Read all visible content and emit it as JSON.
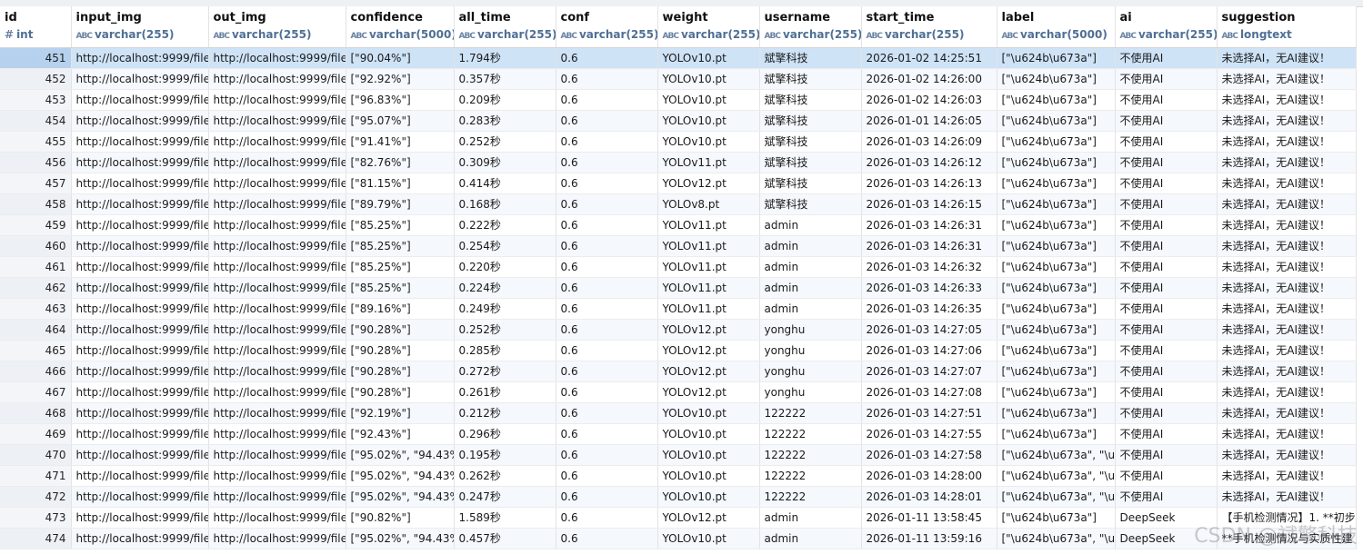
{
  "columns": [
    {
      "name": "id",
      "type": "int",
      "glyph": "#"
    },
    {
      "name": "input_img",
      "type": "varchar(255)",
      "glyph": "ABC"
    },
    {
      "name": "out_img",
      "type": "varchar(255)",
      "glyph": "ABC"
    },
    {
      "name": "confidence",
      "type": "varchar(5000)",
      "glyph": "ABC"
    },
    {
      "name": "all_time",
      "type": "varchar(255)",
      "glyph": "ABC"
    },
    {
      "name": "conf",
      "type": "varchar(255)",
      "glyph": "ABC"
    },
    {
      "name": "weight",
      "type": "varchar(255)",
      "glyph": "ABC"
    },
    {
      "name": "username",
      "type": "varchar(255)",
      "glyph": "ABC"
    },
    {
      "name": "start_time",
      "type": "varchar(255)",
      "glyph": "ABC"
    },
    {
      "name": "label",
      "type": "varchar(5000)",
      "glyph": "ABC"
    },
    {
      "name": "ai",
      "type": "varchar(255)",
      "glyph": "ABC"
    },
    {
      "name": "suggestion",
      "type": "longtext",
      "glyph": "ABC"
    }
  ],
  "rows": [
    [
      "451",
      "http://localhost:9999/file",
      "http://localhost:9999/file",
      "[\"90.04%\"]",
      "1.794秒",
      "0.6",
      "YOLOv10.pt",
      "斌擎科技",
      "2026-01-02 14:25:51",
      "[\"\\u624b\\u673a\"]",
      "不使用AI",
      "未选择AI，无AI建议！"
    ],
    [
      "452",
      "http://localhost:9999/file",
      "http://localhost:9999/file",
      "[\"92.92%\"]",
      "0.357秒",
      "0.6",
      "YOLOv10.pt",
      "斌擎科技",
      "2026-01-02 14:26:00",
      "[\"\\u624b\\u673a\"]",
      "不使用AI",
      "未选择AI，无AI建议！"
    ],
    [
      "453",
      "http://localhost:9999/file",
      "http://localhost:9999/file",
      "[\"96.83%\"]",
      "0.209秒",
      "0.6",
      "YOLOv10.pt",
      "斌擎科技",
      "2026-01-02 14:26:03",
      "[\"\\u624b\\u673a\"]",
      "不使用AI",
      "未选择AI，无AI建议！"
    ],
    [
      "454",
      "http://localhost:9999/file",
      "http://localhost:9999/file",
      "[\"95.07%\"]",
      "0.283秒",
      "0.6",
      "YOLOv10.pt",
      "斌擎科技",
      "2026-01-01 14:26:05",
      "[\"\\u624b\\u673a\"]",
      "不使用AI",
      "未选择AI，无AI建议！"
    ],
    [
      "455",
      "http://localhost:9999/file",
      "http://localhost:9999/file",
      "[\"91.41%\"]",
      "0.252秒",
      "0.6",
      "YOLOv10.pt",
      "斌擎科技",
      "2026-01-03 14:26:09",
      "[\"\\u624b\\u673a\"]",
      "不使用AI",
      "未选择AI，无AI建议！"
    ],
    [
      "456",
      "http://localhost:9999/file",
      "http://localhost:9999/file",
      "[\"82.76%\"]",
      "0.309秒",
      "0.6",
      "YOLOv11.pt",
      "斌擎科技",
      "2026-01-03 14:26:12",
      "[\"\\u624b\\u673a\"]",
      "不使用AI",
      "未选择AI，无AI建议！"
    ],
    [
      "457",
      "http://localhost:9999/file",
      "http://localhost:9999/file",
      "[\"81.15%\"]",
      "0.414秒",
      "0.6",
      "YOLOv12.pt",
      "斌擎科技",
      "2026-01-03 14:26:13",
      "[\"\\u624b\\u673a\"]",
      "不使用AI",
      "未选择AI，无AI建议！"
    ],
    [
      "458",
      "http://localhost:9999/file",
      "http://localhost:9999/file",
      "[\"89.79%\"]",
      "0.168秒",
      "0.6",
      "YOLOv8.pt",
      "斌擎科技",
      "2026-01-03 14:26:15",
      "[\"\\u624b\\u673a\"]",
      "不使用AI",
      "未选择AI，无AI建议！"
    ],
    [
      "459",
      "http://localhost:9999/file",
      "http://localhost:9999/file",
      "[\"85.25%\"]",
      "0.222秒",
      "0.6",
      "YOLOv11.pt",
      "admin",
      "2026-01-03 14:26:31",
      "[\"\\u624b\\u673a\"]",
      "不使用AI",
      "未选择AI，无AI建议！"
    ],
    [
      "460",
      "http://localhost:9999/file",
      "http://localhost:9999/file",
      "[\"85.25%\"]",
      "0.254秒",
      "0.6",
      "YOLOv11.pt",
      "admin",
      "2026-01-03 14:26:31",
      "[\"\\u624b\\u673a\"]",
      "不使用AI",
      "未选择AI，无AI建议！"
    ],
    [
      "461",
      "http://localhost:9999/file",
      "http://localhost:9999/file",
      "[\"85.25%\"]",
      "0.220秒",
      "0.6",
      "YOLOv11.pt",
      "admin",
      "2026-01-03 14:26:32",
      "[\"\\u624b\\u673a\"]",
      "不使用AI",
      "未选择AI，无AI建议！"
    ],
    [
      "462",
      "http://localhost:9999/file",
      "http://localhost:9999/file",
      "[\"85.25%\"]",
      "0.224秒",
      "0.6",
      "YOLOv11.pt",
      "admin",
      "2026-01-03 14:26:33",
      "[\"\\u624b\\u673a\"]",
      "不使用AI",
      "未选择AI，无AI建议！"
    ],
    [
      "463",
      "http://localhost:9999/file",
      "http://localhost:9999/file",
      "[\"89.16%\"]",
      "0.249秒",
      "0.6",
      "YOLOv11.pt",
      "admin",
      "2026-01-03 14:26:35",
      "[\"\\u624b\\u673a\"]",
      "不使用AI",
      "未选择AI，无AI建议！"
    ],
    [
      "464",
      "http://localhost:9999/file",
      "http://localhost:9999/file",
      "[\"90.28%\"]",
      "0.252秒",
      "0.6",
      "YOLOv12.pt",
      "yonghu",
      "2026-01-03 14:27:05",
      "[\"\\u624b\\u673a\"]",
      "不使用AI",
      "未选择AI，无AI建议！"
    ],
    [
      "465",
      "http://localhost:9999/file",
      "http://localhost:9999/file",
      "[\"90.28%\"]",
      "0.285秒",
      "0.6",
      "YOLOv12.pt",
      "yonghu",
      "2026-01-03 14:27:06",
      "[\"\\u624b\\u673a\"]",
      "不使用AI",
      "未选择AI，无AI建议！"
    ],
    [
      "466",
      "http://localhost:9999/file",
      "http://localhost:9999/file",
      "[\"90.28%\"]",
      "0.272秒",
      "0.6",
      "YOLOv12.pt",
      "yonghu",
      "2026-01-03 14:27:07",
      "[\"\\u624b\\u673a\"]",
      "不使用AI",
      "未选择AI，无AI建议！"
    ],
    [
      "467",
      "http://localhost:9999/file",
      "http://localhost:9999/file",
      "[\"90.28%\"]",
      "0.261秒",
      "0.6",
      "YOLOv12.pt",
      "yonghu",
      "2026-01-03 14:27:08",
      "[\"\\u624b\\u673a\"]",
      "不使用AI",
      "未选择AI，无AI建议！"
    ],
    [
      "468",
      "http://localhost:9999/file",
      "http://localhost:9999/file",
      "[\"92.19%\"]",
      "0.212秒",
      "0.6",
      "YOLOv10.pt",
      "122222",
      "2026-01-03 14:27:51",
      "[\"\\u624b\\u673a\"]",
      "不使用AI",
      "未选择AI，无AI建议！"
    ],
    [
      "469",
      "http://localhost:9999/file",
      "http://localhost:9999/file",
      "[\"92.43%\"]",
      "0.296秒",
      "0.6",
      "YOLOv10.pt",
      "122222",
      "2026-01-03 14:27:55",
      "[\"\\u624b\\u673a\"]",
      "不使用AI",
      "未选择AI，无AI建议！"
    ],
    [
      "470",
      "http://localhost:9999/file",
      "http://localhost:9999/file",
      "[\"95.02%\", \"94.43%",
      "0.195秒",
      "0.6",
      "YOLOv10.pt",
      "122222",
      "2026-01-03 14:27:58",
      "[\"\\u624b\\u673a\", \"\\u",
      "不使用AI",
      "未选择AI，无AI建议！"
    ],
    [
      "471",
      "http://localhost:9999/file",
      "http://localhost:9999/file",
      "[\"95.02%\", \"94.43%",
      "0.262秒",
      "0.6",
      "YOLOv10.pt",
      "122222",
      "2026-01-03 14:28:00",
      "[\"\\u624b\\u673a\", \"\\u",
      "不使用AI",
      "未选择AI，无AI建议！"
    ],
    [
      "472",
      "http://localhost:9999/file",
      "http://localhost:9999/file",
      "[\"95.02%\", \"94.43%",
      "0.247秒",
      "0.6",
      "YOLOv10.pt",
      "122222",
      "2026-01-03 14:28:01",
      "[\"\\u624b\\u673a\", \"\\u",
      "不使用AI",
      "未选择AI，无AI建议！"
    ],
    [
      "473",
      "http://localhost:9999/file",
      "http://localhost:9999/file",
      "[\"90.82%\"]",
      "1.589秒",
      "0.6",
      "YOLOv12.pt",
      "admin",
      "2026-01-11 13:58:45",
      "[\"\\u624b\\u673a\"]",
      "DeepSeek",
      "【手机检测情况】1. **初步"
    ],
    [
      "474",
      "http://localhost:9999/file",
      "http://localhost:9999/file",
      "[\"95.02%\", \"94.43%",
      "0.457秒",
      "0.6",
      "YOLOv10.pt",
      "admin",
      "2026-01-11 13:59:16",
      "[\"\\u624b\\u673a\", \"\\u",
      "DeepSeek",
      "**手机检测情况与实质性建"
    ]
  ],
  "selected_row_id": "451",
  "watermark": "CSDN @斌擎科技",
  "colors": {
    "accent": "#cfe3f7",
    "header_id": "#dde7f3",
    "type_text": "#4f6f95"
  }
}
